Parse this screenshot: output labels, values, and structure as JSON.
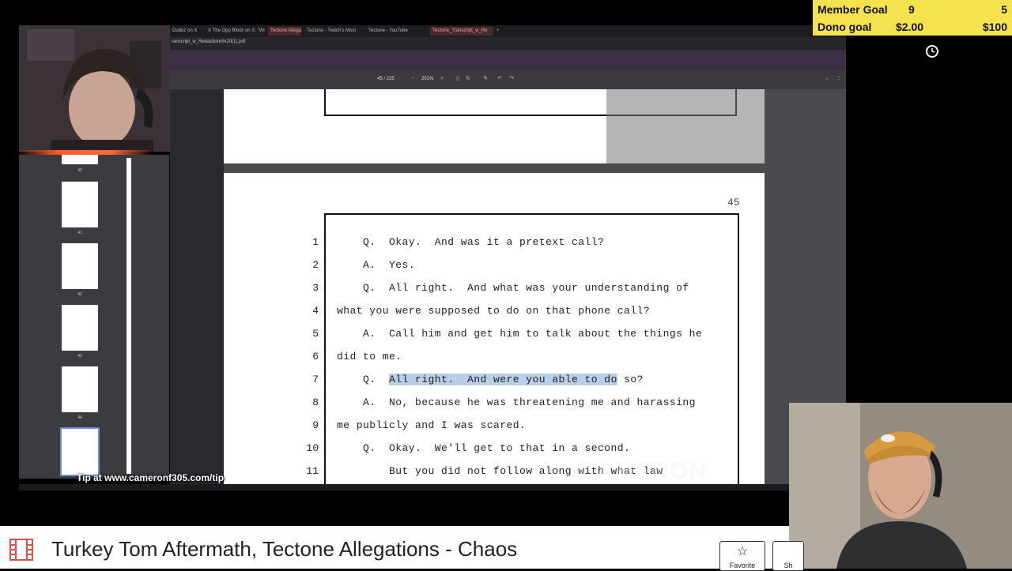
{
  "stream": {
    "member_goal_label": "Member Goal",
    "member_goal_current": "9",
    "member_goal_target": "5",
    "dono_goal_label": "Dono goal",
    "dono_goal_current": "$2.00",
    "dono_goal_target": "$100",
    "tip_line": "Tip at www.cameronf305.com/tip",
    "watermark": "CAMERON"
  },
  "browser": {
    "tabs": [
      {
        "label": "Dubbz on X"
      },
      {
        "label": "X The Opp Block on X: \"Wr"
      },
      {
        "label": "Tectone Allega"
      },
      {
        "label": "Tectone - Twitch's Most"
      },
      {
        "label": "Tectone - YouTube"
      },
      {
        "label": "Tectone_Transcript_w_Re"
      }
    ],
    "url": "ranscript_w_Redactions%20(1).pdf"
  },
  "pdf": {
    "page_indicator": "45 / 225",
    "zoom": "201%",
    "thumbs": [
      "40",
      "41",
      "42",
      "43",
      "44",
      "45"
    ],
    "page_number": "45",
    "lines": [
      {
        "num": "1",
        "text": "    Q.  Okay.  And was it a pretext call?"
      },
      {
        "num": "2",
        "text": "    A.  Yes."
      },
      {
        "num": "3",
        "text": "    Q.  All right.  And what was your understanding of"
      },
      {
        "num": "4",
        "text": "what you were supposed to do on that phone call?"
      },
      {
        "num": "5",
        "text": "    A.  Call him and get him to talk about the things he"
      },
      {
        "num": "6",
        "text": "did to me."
      },
      {
        "num": "7",
        "pre": "    Q.  ",
        "hl": "All right.  And were you able to do",
        "post": " so?"
      },
      {
        "num": "8",
        "text": "    A.  No, because he was threatening me and harassing"
      },
      {
        "num": "9",
        "text": "me publicly and I was scared."
      },
      {
        "num": "10",
        "text": "    Q.  Okay.  We'll get to that in a second."
      },
      {
        "num": "11",
        "text": "        But you did not follow along with what law"
      }
    ]
  },
  "video": {
    "title": "Turkey Tom Aftermath, Tectone Allegations - Chaos",
    "favorite_label": "Favorite",
    "share_label": "Sh"
  }
}
